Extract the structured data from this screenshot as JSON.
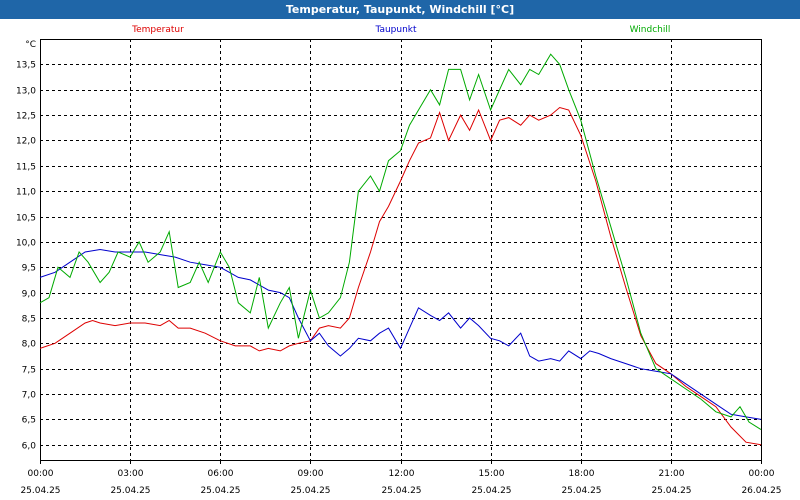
{
  "window": {
    "title": "Temperatur, Taupunkt, Windchill [°C]"
  },
  "colors": {
    "titlebar": "#1f66a8",
    "grid": "#000000"
  },
  "chart_data": {
    "type": "line",
    "title": "Temperatur, Taupunkt, Windchill [°C]",
    "yunit": "°C",
    "ylim": [
      5.7,
      14.0
    ],
    "yticks": [
      6.0,
      6.5,
      7.0,
      7.5,
      8.0,
      8.5,
      9.0,
      9.5,
      10.0,
      10.5,
      11.0,
      11.5,
      12.0,
      12.5,
      13.0,
      13.5
    ],
    "ytick_labels": [
      "6,0",
      "6,5",
      "7,0",
      "7,5",
      "8,0",
      "8,5",
      "9,0",
      "9,5",
      "10,0",
      "10,5",
      "11,0",
      "11,5",
      "12,0",
      "12,5",
      "13,0",
      "13,5"
    ],
    "xlim": [
      0,
      24
    ],
    "xticks": [
      0,
      3,
      6,
      9,
      12,
      15,
      18,
      21,
      24
    ],
    "xtick_time_labels": [
      "00:00",
      "03:00",
      "06:00",
      "09:00",
      "12:00",
      "15:00",
      "18:00",
      "21:00",
      "00:00"
    ],
    "xtick_date_labels": [
      "25.04.25",
      "25.04.25",
      "25.04.25",
      "25.04.25",
      "25.04.25",
      "25.04.25",
      "25.04.25",
      "25.04.25",
      "26.04.25"
    ],
    "grid": true,
    "series": [
      {
        "name": "Temperatur",
        "color": "#dd0000",
        "x": [
          0,
          0.5,
          1,
          1.5,
          1.75,
          2,
          2.5,
          3,
          3.5,
          4,
          4.3,
          4.6,
          5,
          5.5,
          6,
          6.5,
          7,
          7.3,
          7.6,
          8,
          8.3,
          8.6,
          9,
          9.3,
          9.6,
          10,
          10.3,
          10.6,
          11,
          11.3,
          11.6,
          12,
          12.3,
          12.6,
          13,
          13.3,
          13.6,
          14,
          14.3,
          14.6,
          15,
          15.3,
          15.6,
          16,
          16.3,
          16.6,
          17,
          17.3,
          17.6,
          18,
          18.5,
          19,
          19.5,
          20,
          20.5,
          21,
          21.5,
          22,
          22.5,
          23,
          23.5,
          24
        ],
        "values": [
          7.9,
          8.0,
          8.2,
          8.4,
          8.45,
          8.4,
          8.35,
          8.4,
          8.4,
          8.35,
          8.45,
          8.3,
          8.3,
          8.2,
          8.05,
          7.95,
          7.95,
          7.85,
          7.9,
          7.85,
          7.95,
          8.0,
          8.05,
          8.3,
          8.35,
          8.3,
          8.5,
          9.1,
          9.8,
          10.4,
          10.7,
          11.2,
          11.6,
          11.95,
          12.05,
          12.55,
          12.0,
          12.5,
          12.2,
          12.6,
          12.0,
          12.4,
          12.45,
          12.3,
          12.5,
          12.4,
          12.5,
          12.65,
          12.6,
          12.1,
          11.2,
          10.1,
          9.1,
          8.15,
          7.6,
          7.4,
          7.15,
          6.95,
          6.75,
          6.35,
          6.05,
          6.0
        ]
      },
      {
        "name": "Taupunkt",
        "color": "#0000cc",
        "x": [
          0,
          0.5,
          1,
          1.5,
          2,
          2.5,
          3,
          3.5,
          4,
          4.5,
          5,
          5.5,
          6,
          6.3,
          6.6,
          7,
          7.3,
          7.6,
          8,
          8.3,
          8.6,
          9,
          9.3,
          9.6,
          10,
          10.3,
          10.6,
          11,
          11.3,
          11.6,
          12,
          12.3,
          12.6,
          13,
          13.3,
          13.6,
          14,
          14.3,
          14.6,
          15,
          15.3,
          15.6,
          16,
          16.3,
          16.6,
          17,
          17.3,
          17.6,
          18,
          18.3,
          18.6,
          19,
          19.5,
          20,
          20.5,
          21,
          21.5,
          22,
          22.5,
          23,
          23.5,
          24
        ],
        "values": [
          9.3,
          9.4,
          9.6,
          9.8,
          9.85,
          9.8,
          9.8,
          9.8,
          9.75,
          9.7,
          9.6,
          9.55,
          9.5,
          9.4,
          9.3,
          9.25,
          9.15,
          9.05,
          9.0,
          8.9,
          8.5,
          8.05,
          8.2,
          7.95,
          7.75,
          7.9,
          8.1,
          8.05,
          8.2,
          8.3,
          7.9,
          8.3,
          8.7,
          8.55,
          8.45,
          8.6,
          8.3,
          8.5,
          8.35,
          8.1,
          8.05,
          7.95,
          8.2,
          7.75,
          7.65,
          7.7,
          7.65,
          7.85,
          7.7,
          7.85,
          7.8,
          7.7,
          7.6,
          7.5,
          7.45,
          7.4,
          7.2,
          7.0,
          6.8,
          6.6,
          6.55,
          6.5
        ]
      },
      {
        "name": "Windchill",
        "color": "#00aa00",
        "x": [
          0,
          0.3,
          0.6,
          1,
          1.3,
          1.6,
          2,
          2.3,
          2.6,
          3,
          3.3,
          3.6,
          4,
          4.3,
          4.6,
          5,
          5.3,
          5.6,
          6,
          6.3,
          6.6,
          7,
          7.3,
          7.6,
          8,
          8.3,
          8.6,
          9,
          9.3,
          9.6,
          10,
          10.3,
          10.6,
          11,
          11.3,
          11.6,
          12,
          12.3,
          12.6,
          13,
          13.3,
          13.6,
          14,
          14.3,
          14.6,
          15,
          15.3,
          15.6,
          16,
          16.3,
          16.6,
          17,
          17.3,
          17.6,
          18,
          18.5,
          19,
          19.5,
          20,
          20.5,
          21,
          21.5,
          22,
          22.5,
          23,
          23.3,
          23.6,
          24
        ],
        "values": [
          8.8,
          8.9,
          9.5,
          9.3,
          9.8,
          9.6,
          9.2,
          9.4,
          9.8,
          9.7,
          10.0,
          9.6,
          9.8,
          10.2,
          9.1,
          9.2,
          9.6,
          9.2,
          9.8,
          9.5,
          8.8,
          8.6,
          9.3,
          8.3,
          8.8,
          9.1,
          8.1,
          9.05,
          8.5,
          8.6,
          8.9,
          9.6,
          11.0,
          11.3,
          11.0,
          11.6,
          11.8,
          12.3,
          12.6,
          13.0,
          12.7,
          13.4,
          13.4,
          12.8,
          13.3,
          12.6,
          13.0,
          13.4,
          13.1,
          13.4,
          13.3,
          13.7,
          13.5,
          13.0,
          12.4,
          11.3,
          10.3,
          9.3,
          8.2,
          7.5,
          7.3,
          7.1,
          6.9,
          6.65,
          6.55,
          6.75,
          6.45,
          6.3
        ]
      }
    ]
  }
}
